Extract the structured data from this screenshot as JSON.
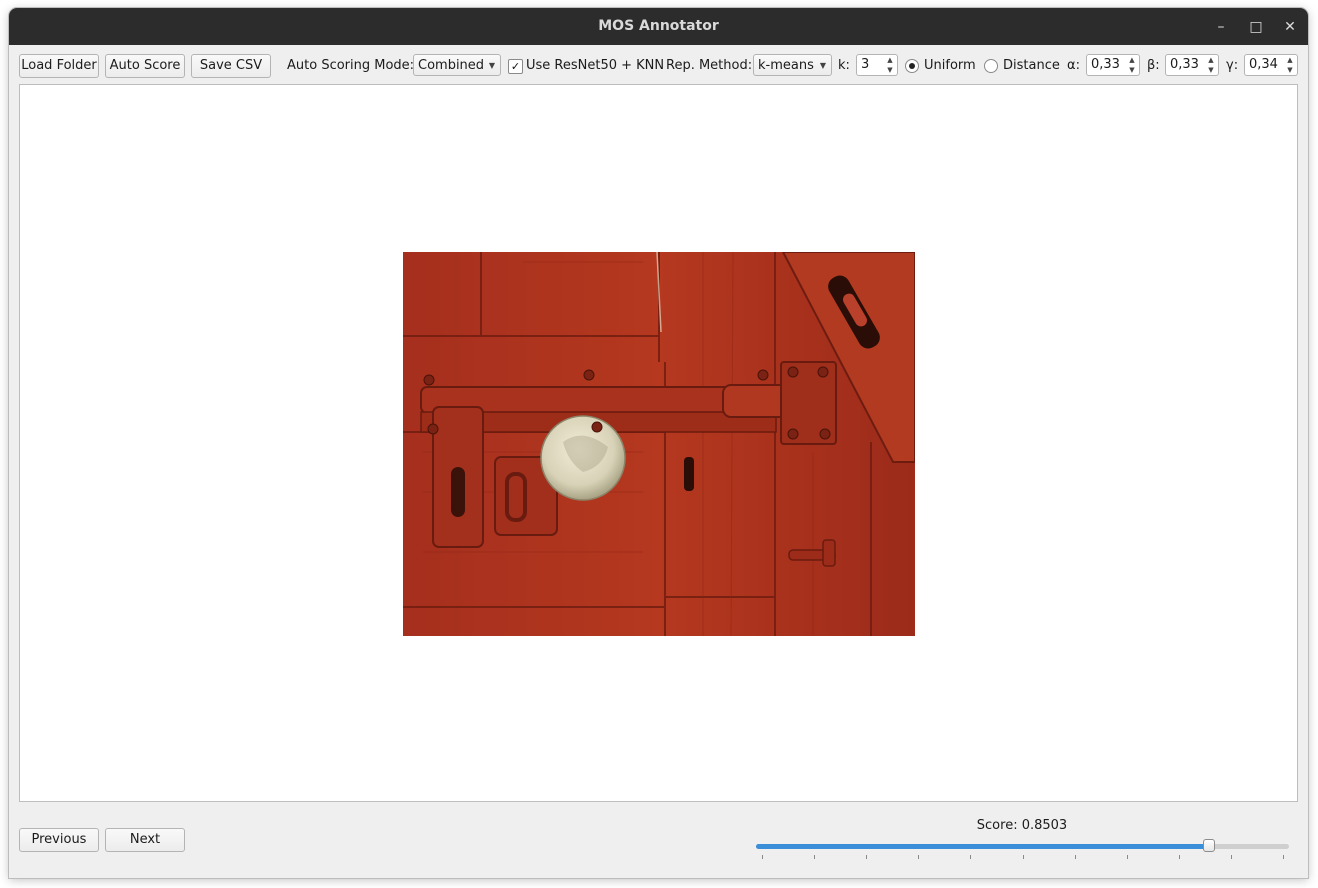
{
  "window": {
    "title": "MOS Annotator",
    "controls": {
      "minimize": "–",
      "maximize": "□",
      "close": "✕"
    }
  },
  "toolbar": {
    "load_folder": "Load Folder",
    "auto_score": "Auto Score",
    "save_csv": "Save CSV",
    "auto_scoring_mode_label": "Auto Scoring Mode:",
    "auto_scoring_mode_value": "Combined",
    "use_resnet_checked": true,
    "use_resnet_label": "Use ResNet50 + KNN",
    "rep_method_label": "Rep. Method:",
    "rep_method_value": "k-means",
    "k_label": "k:",
    "k_value": "3",
    "uniform_label": "Uniform",
    "uniform_selected": true,
    "distance_label": "Distance",
    "distance_selected": false,
    "alpha_label": "α:",
    "alpha_value": "0,33",
    "beta_label": "β:",
    "beta_value": "0,33",
    "gamma_label": "γ:",
    "gamma_value": "0,34"
  },
  "navigation": {
    "previous": "Previous",
    "next": "Next"
  },
  "score": {
    "label": "Score: 0.8503",
    "value": 0.8503,
    "tick_count": 11
  },
  "colors": {
    "accent": "#3b8fd9",
    "titlebar": "#2c2c2c",
    "door_red": "#a8321f"
  },
  "image": {
    "description_icon": "image-viewer"
  }
}
